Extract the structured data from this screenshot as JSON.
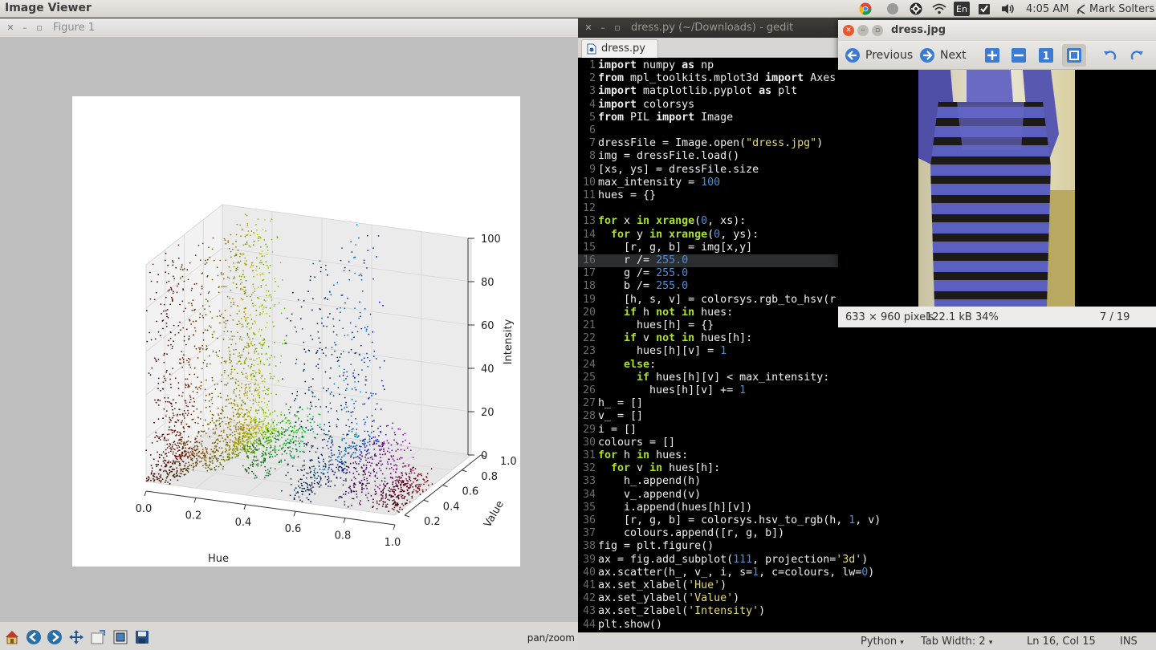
{
  "top_panel": {
    "app_title": "Image Viewer",
    "keyboard_layout": "En",
    "clock": "4:05 AM",
    "user": "Mark Solters"
  },
  "figure_window": {
    "title": "Figure 1",
    "toolbar_mode": "pan/zoom",
    "toolbar_icons": [
      "home-icon",
      "back-icon",
      "forward-icon",
      "pan-icon",
      "zoom-icon",
      "subplots-icon",
      "save-icon"
    ]
  },
  "chart_data": {
    "type": "scatter",
    "projection": "3d",
    "xlabel": "Hue",
    "ylabel": "Value",
    "zlabel": "Intensity",
    "x_ticks": [
      "0.0",
      "0.2",
      "0.4",
      "0.6",
      "0.8",
      "1.0"
    ],
    "y_ticks": [
      "0.2",
      "0.4",
      "0.6",
      "0.8",
      "1.0"
    ],
    "z_ticks": [
      "0",
      "20",
      "40",
      "60",
      "80",
      "100"
    ],
    "xlim": [
      0.0,
      1.0
    ],
    "ylim": [
      0.2,
      1.0
    ],
    "zlim": [
      0,
      100
    ],
    "clusters": [
      {
        "hue": 0.05,
        "value_range": [
          0.2,
          0.6
        ],
        "peak_intensity": 100,
        "color": "#5a3a1a"
      },
      {
        "hue": 0.15,
        "value_range": [
          0.4,
          1.0
        ],
        "peak_intensity": 100,
        "color": "#ff9a00"
      },
      {
        "hue": 0.2,
        "value_range": [
          0.6,
          1.0
        ],
        "peak_intensity": 100,
        "color": "#ffe000"
      },
      {
        "hue": 0.35,
        "value_range": [
          0.4,
          1.0
        ],
        "peak_intensity": 15,
        "color": "#40c040"
      },
      {
        "hue": 0.6,
        "value_range": [
          0.2,
          1.0
        ],
        "peak_intensity": 100,
        "color": "#2040d0"
      },
      {
        "hue": 0.8,
        "value_range": [
          0.2,
          0.8
        ],
        "peak_intensity": 20,
        "color": "#8030a0"
      },
      {
        "hue": 0.95,
        "value_range": [
          0.2,
          0.6
        ],
        "peak_intensity": 10,
        "color": "#a02030"
      }
    ]
  },
  "gedit": {
    "title": "dress.py (~/Downloads) - gedit",
    "tab_label": "dress.py",
    "code_lines": [
      [
        [
          "kw",
          "import"
        ],
        [
          "t",
          " numpy "
        ],
        [
          "kw",
          "as"
        ],
        [
          "t",
          " np"
        ]
      ],
      [
        [
          "kw",
          "from"
        ],
        [
          "t",
          " mpl_toolkits.mplot3d "
        ],
        [
          "kw",
          "import"
        ],
        [
          "t",
          " Axes"
        ]
      ],
      [
        [
          "kw",
          "import"
        ],
        [
          "t",
          " matplotlib.pyplot "
        ],
        [
          "kw",
          "as"
        ],
        [
          "t",
          " plt"
        ]
      ],
      [
        [
          "kw",
          "import"
        ],
        [
          "t",
          " colorsys"
        ]
      ],
      [
        [
          "kw",
          "from"
        ],
        [
          "t",
          " PIL "
        ],
        [
          "kw",
          "import"
        ],
        [
          "t",
          " Image"
        ]
      ],
      [],
      [
        [
          "t",
          "dressFile = Image.open("
        ],
        [
          "str",
          "\"dress.jpg\""
        ],
        [
          "t",
          ")"
        ]
      ],
      [
        [
          "t",
          "img = dressFile.load()"
        ]
      ],
      [
        [
          "t",
          "[xs, ys] = dressFile.size"
        ]
      ],
      [
        [
          "t",
          "max_intensity = "
        ],
        [
          "num",
          "100"
        ]
      ],
      [
        [
          "t",
          "hues = {}"
        ]
      ],
      [],
      [
        [
          "bi",
          "for"
        ],
        [
          "t",
          " x "
        ],
        [
          "bi",
          "in"
        ],
        [
          "t",
          " "
        ],
        [
          "bi",
          "xrange"
        ],
        [
          "t",
          "("
        ],
        [
          "num",
          "0"
        ],
        [
          "t",
          ", xs):"
        ]
      ],
      [
        [
          "t",
          "  "
        ],
        [
          "bi",
          "for"
        ],
        [
          "t",
          " y "
        ],
        [
          "bi",
          "in"
        ],
        [
          "t",
          " "
        ],
        [
          "bi",
          "xrange"
        ],
        [
          "t",
          "("
        ],
        [
          "num",
          "0"
        ],
        [
          "t",
          ", ys):"
        ]
      ],
      [
        [
          "t",
          "    [r, g, b] = img[x,y]"
        ]
      ],
      [
        [
          "t",
          "    r /= "
        ],
        [
          "num",
          "255.0"
        ]
      ],
      [
        [
          "t",
          "    g /= "
        ],
        [
          "num",
          "255.0"
        ]
      ],
      [
        [
          "t",
          "    b /= "
        ],
        [
          "num",
          "255.0"
        ]
      ],
      [
        [
          "t",
          "    [h, s, v] = colorsys.rgb_to_hsv(r"
        ]
      ],
      [
        [
          "t",
          "    "
        ],
        [
          "bi",
          "if"
        ],
        [
          "t",
          " h "
        ],
        [
          "bi",
          "not in"
        ],
        [
          "t",
          " hues:"
        ]
      ],
      [
        [
          "t",
          "      hues[h] = {}"
        ]
      ],
      [
        [
          "t",
          "    "
        ],
        [
          "bi",
          "if"
        ],
        [
          "t",
          " v "
        ],
        [
          "bi",
          "not in"
        ],
        [
          "t",
          " hues[h]:"
        ]
      ],
      [
        [
          "t",
          "      hues[h][v] = "
        ],
        [
          "num",
          "1"
        ]
      ],
      [
        [
          "t",
          "    "
        ],
        [
          "bi",
          "else"
        ],
        [
          "t",
          ":"
        ]
      ],
      [
        [
          "t",
          "      "
        ],
        [
          "bi",
          "if"
        ],
        [
          "t",
          " hues[h][v] < max_intensity:"
        ]
      ],
      [
        [
          "t",
          "        hues[h][v] += "
        ],
        [
          "num",
          "1"
        ]
      ],
      [
        [
          "t",
          "h_ = []"
        ]
      ],
      [
        [
          "t",
          "v_ = []"
        ]
      ],
      [
        [
          "t",
          "i = []"
        ]
      ],
      [
        [
          "t",
          "colours = []"
        ]
      ],
      [
        [
          "bi",
          "for"
        ],
        [
          "t",
          " h "
        ],
        [
          "bi",
          "in"
        ],
        [
          "t",
          " hues:"
        ]
      ],
      [
        [
          "t",
          "  "
        ],
        [
          "bi",
          "for"
        ],
        [
          "t",
          " v "
        ],
        [
          "bi",
          "in"
        ],
        [
          "t",
          " hues[h]:"
        ]
      ],
      [
        [
          "t",
          "    h_.append(h)"
        ]
      ],
      [
        [
          "t",
          "    v_.append(v)"
        ]
      ],
      [
        [
          "t",
          "    i.append(hues[h][v])"
        ]
      ],
      [
        [
          "t",
          "    [r, g, b] = colorsys.hsv_to_rgb(h, "
        ],
        [
          "num",
          "1"
        ],
        [
          "t",
          ", v)"
        ]
      ],
      [
        [
          "t",
          "    colours.append([r, g, b])"
        ]
      ],
      [
        [
          "t",
          "fig = plt.figure()"
        ]
      ],
      [
        [
          "t",
          "ax = fig.add_subplot("
        ],
        [
          "num",
          "111"
        ],
        [
          "t",
          ", projection="
        ],
        [
          "str",
          "'3d'"
        ],
        [
          "t",
          ")"
        ]
      ],
      [
        [
          "t",
          "ax.scatter(h_, v_, i, s="
        ],
        [
          "num",
          "1"
        ],
        [
          "t",
          ", c=colours, lw="
        ],
        [
          "num",
          "0"
        ],
        [
          "t",
          ")"
        ]
      ],
      [
        [
          "t",
          "ax.set_xlabel("
        ],
        [
          "str",
          "'Hue'"
        ],
        [
          "t",
          ")"
        ]
      ],
      [
        [
          "t",
          "ax.set_ylabel("
        ],
        [
          "str",
          "'Value'"
        ],
        [
          "t",
          ")"
        ]
      ],
      [
        [
          "t",
          "ax.set_zlabel("
        ],
        [
          "str",
          "'Intensity'"
        ],
        [
          "t",
          ")"
        ]
      ],
      [
        [
          "t",
          "plt.show()"
        ]
      ]
    ],
    "current_line": 16,
    "status": {
      "language": "Python",
      "tab_width": "Tab Width: 2",
      "cursor": "Ln 16, Col 15",
      "mode": "INS"
    }
  },
  "image_viewer": {
    "title": "dress.jpg",
    "previous_label": "Previous",
    "next_label": "Next",
    "dimensions": "633 × 960 pixels",
    "file_size": "122.1 kB",
    "zoom": "34%",
    "position": "7 / 19"
  }
}
